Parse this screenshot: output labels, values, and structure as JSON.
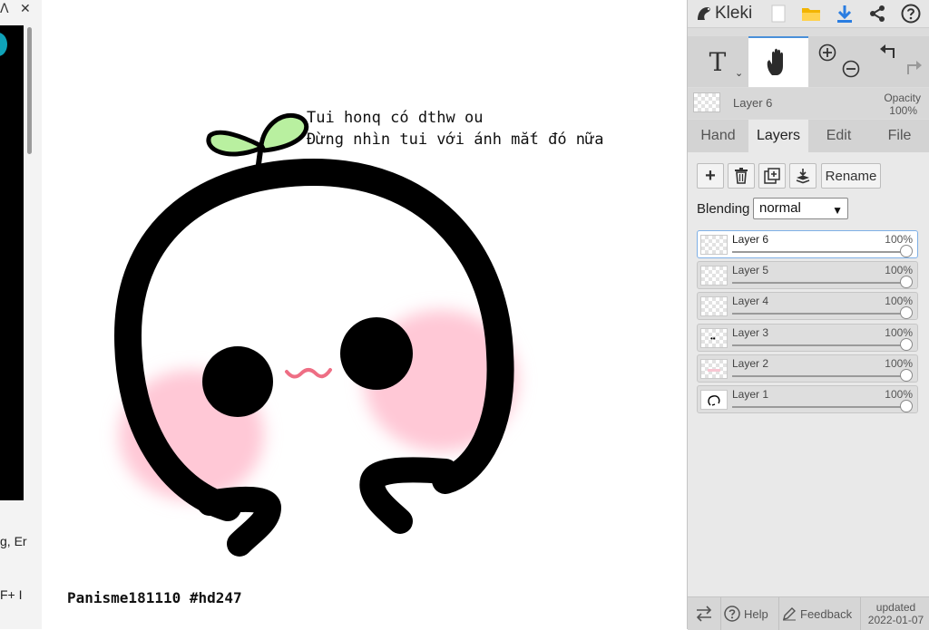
{
  "browser": {
    "tab_controls": [
      "ᐱ",
      "✕"
    ],
    "snippet_1": "g, Er",
    "snippet_2": "F+ I"
  },
  "canvas": {
    "caption_line1": "Tui honq có dthw ou",
    "caption_line2": "Đừng nhìn tui với ánh mắt đó nữa",
    "signature": "Panisme181110 #hd247"
  },
  "app": {
    "name": "Kleki",
    "top_icons": [
      "new-file-icon",
      "open-folder-icon",
      "download-icon",
      "share-icon",
      "help-circle-icon"
    ],
    "tools": [
      "text-tool-icon",
      "hand-tool-icon",
      "zoom-in-icon",
      "zoom-out-icon",
      "undo-icon",
      "redo-icon"
    ],
    "text_tool_glyph": "T",
    "active_tool": "hand"
  },
  "layer_info": {
    "name": "Layer 6",
    "opacity_label": "Opacity",
    "opacity_value": "100%"
  },
  "tabs": [
    {
      "label": "Hand",
      "active": false
    },
    {
      "label": "Layers",
      "active": true
    },
    {
      "label": "Edit",
      "active": false
    },
    {
      "label": "File",
      "active": false
    }
  ],
  "layers_panel": {
    "buttons": {
      "rename": "Rename"
    },
    "blending_label": "Blending",
    "blending_value": "normal",
    "layers": [
      {
        "name": "Layer 6",
        "opacity": "100%",
        "selected": true
      },
      {
        "name": "Layer 5",
        "opacity": "100%",
        "selected": false
      },
      {
        "name": "Layer 4",
        "opacity": "100%",
        "selected": false
      },
      {
        "name": "Layer 3",
        "opacity": "100%",
        "selected": false
      },
      {
        "name": "Layer 2",
        "opacity": "100%",
        "selected": false
      },
      {
        "name": "Layer 1",
        "opacity": "100%",
        "selected": false
      }
    ]
  },
  "bottom_bar": {
    "help": "Help",
    "feedback": "Feedback",
    "updated_label": "updated",
    "updated_date": "2022-01-07"
  },
  "colors": {
    "accent": "#4a90d9",
    "download": "#2a7de1",
    "folder": "#f2b400",
    "sprout": "#b9f0a0",
    "blush": "#ffc8d6",
    "mouth": "#ee6e84"
  }
}
